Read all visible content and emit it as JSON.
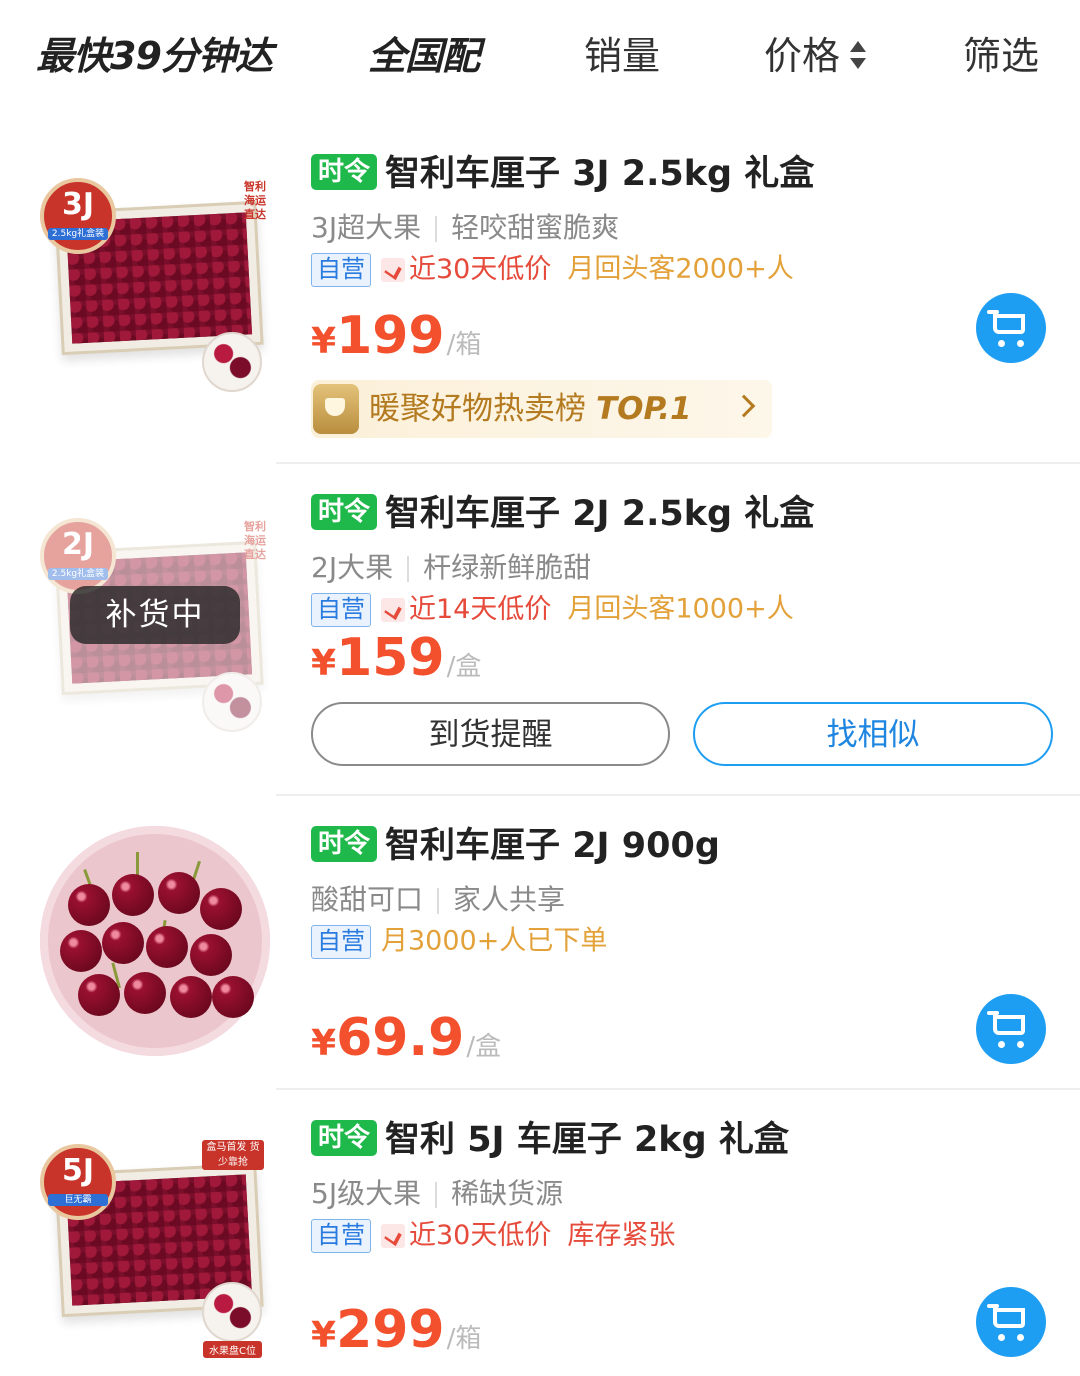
{
  "tabs": [
    {
      "label": "最快39分钟达"
    },
    {
      "label": "全国配"
    },
    {
      "label": "销量"
    },
    {
      "label": "价格"
    },
    {
      "label": "筛选"
    }
  ],
  "products": [
    {
      "tag": "时令",
      "name": "智利车厘子 3J 2.5kg 礼盒",
      "desc": [
        "3J超大果",
        "轻咬甜蜜脆爽"
      ],
      "self_operated": "自营",
      "low_price": "近30天低价",
      "extra": "月回头客2000+人",
      "price_symbol": "¥",
      "price": "199",
      "unit": "/箱",
      "ranking": {
        "text": "暖聚好物热卖榜",
        "rank": "TOP.1"
      },
      "image": {
        "badge": "3J",
        "badge_sub": "2.5kg礼盒装",
        "side_text": "智利 海运直达"
      }
    },
    {
      "tag": "时令",
      "name": "智利车厘子 2J 2.5kg 礼盒",
      "desc": [
        "2J大果",
        "杆绿新鲜脆甜"
      ],
      "self_operated": "自营",
      "low_price": "近14天低价",
      "extra": "月回头客1000+人",
      "price_symbol": "¥",
      "price": "159",
      "unit": "/盒",
      "status": "补货中",
      "buttons": {
        "remind": "到货提醒",
        "similar": "找相似"
      },
      "image": {
        "badge": "2J",
        "badge_sub": "2.5kg礼盒装",
        "side_text": "智利 海运直达"
      }
    },
    {
      "tag": "时令",
      "name": "智利车厘子 2J 900g",
      "desc": [
        "酸甜可口",
        "家人共享"
      ],
      "self_operated": "自营",
      "extra": "月3000+人已下单",
      "price_symbol": "¥",
      "price": "69.9",
      "unit": "/盒"
    },
    {
      "tag": "时令",
      "name": "智利 5J 车厘子 2kg 礼盒",
      "desc": [
        "5J级大果",
        "稀缺货源"
      ],
      "self_operated": "自营",
      "low_price": "近30天低价",
      "extra": "库存紧张",
      "price_symbol": "¥",
      "price": "299",
      "unit": "/箱",
      "image": {
        "badge": "5J",
        "badge_sub": "巨无霸",
        "label_top": "盒马首发 货少靠抢",
        "label_bottom": "水果盘C位"
      }
    }
  ],
  "colors": {
    "price": "#f3502d",
    "seasonal_tag": "#1fb84a",
    "self_operated": "#2a7be0",
    "low_price": "#e64a3b",
    "cart": "#1e9ef2"
  }
}
